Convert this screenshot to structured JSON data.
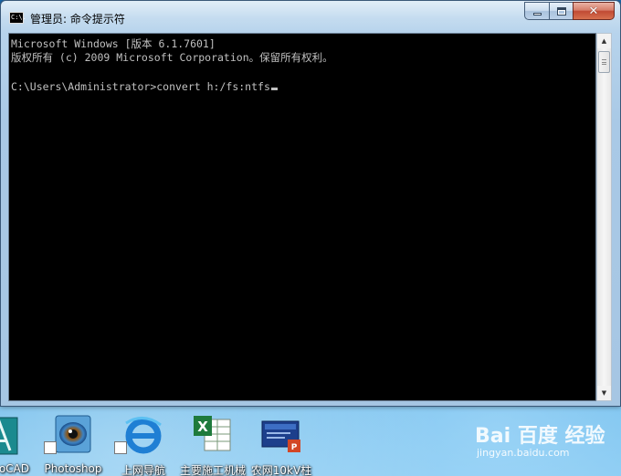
{
  "window": {
    "title": "管理员: 命令提示符",
    "icon_text": "C:\\.",
    "console_lines": [
      "Microsoft Windows [版本 6.1.7601]",
      "版权所有 (c) 2009 Microsoft Corporation。保留所有权利。",
      "C:\\Users\\Administrator>convert h:/fs:ntfs"
    ]
  },
  "desktop": {
    "icons": [
      {
        "label": "oCAD",
        "icon": "autocad-icon"
      },
      {
        "label": "Photoshop",
        "icon": "photoshop-icon"
      },
      {
        "label": "上网导航",
        "icon": "internet-explorer-icon"
      },
      {
        "label": "主要施工机械",
        "icon": "excel-icon"
      },
      {
        "label": "农网10kV柱",
        "icon": "powerpoint-icon"
      }
    ]
  },
  "watermark": {
    "logo": "Bai 百度 经验",
    "url": "jingyan.baidu.com"
  }
}
